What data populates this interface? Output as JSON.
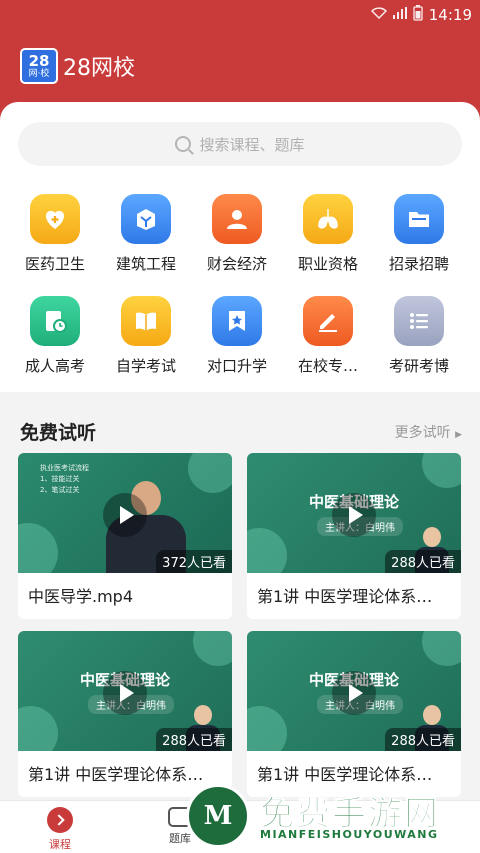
{
  "status": {
    "time": "14:19"
  },
  "app": {
    "logo_number": "28",
    "logo_sub": "网·校",
    "name": "28网校"
  },
  "search": {
    "placeholder": "搜索课程、题库"
  },
  "categories": [
    {
      "label": "医药卫生",
      "icon": "heart-plus-icon",
      "color": "#f6b81c"
    },
    {
      "label": "建筑工程",
      "icon": "building-icon",
      "color": "#3f8ef0"
    },
    {
      "label": "财会经济",
      "icon": "person-icon",
      "color": "#f2692c"
    },
    {
      "label": "职业资格",
      "icon": "lungs-icon",
      "color": "#f6b81c"
    },
    {
      "label": "招录招聘",
      "icon": "folder-icon",
      "color": "#3f8ef0"
    },
    {
      "label": "成人高考",
      "icon": "clock-doc-icon",
      "color": "#2bbf8a"
    },
    {
      "label": "自学考试",
      "icon": "book-icon",
      "color": "#f6b81c"
    },
    {
      "label": "对口升学",
      "icon": "badge-icon",
      "color": "#3f8ef0"
    },
    {
      "label": "在校专…",
      "icon": "pencil-icon",
      "color": "#f2692c"
    },
    {
      "label": "考研考博",
      "icon": "list-icon",
      "color": "#a5adc9"
    }
  ],
  "free_section": {
    "title": "免费试听",
    "more": "更多试听"
  },
  "videos": [
    {
      "views": "372人已看",
      "caption": "中医导学.mp4",
      "slide_lines": [
        "执业医考试流程",
        "1、技能过关",
        "2、笔试过关"
      ]
    },
    {
      "views": "288人已看",
      "caption": "第1讲 中医学理论体系…",
      "slide_title": "中医基础理论",
      "slide_sub": "主讲人：白明伟"
    },
    {
      "views": "288人已看",
      "caption": "第1讲 中医学理论体系…",
      "slide_title": "中医基础理论",
      "slide_sub": "主讲人：白明伟"
    },
    {
      "views": "288人已看",
      "caption": "第1讲 中医学理论体系…",
      "slide_title": "中医基础理论",
      "slide_sub": "主讲人：白明伟"
    }
  ],
  "tabs": [
    {
      "label": "课程",
      "active": true
    },
    {
      "label": "题库",
      "active": false
    }
  ],
  "watermark": {
    "title": "免费手游网",
    "sub": "MIANFEISHOUYOUWANG",
    "glyph": "M"
  },
  "colors": {
    "primary": "#c93b3b",
    "green": "#1e7a3c"
  }
}
